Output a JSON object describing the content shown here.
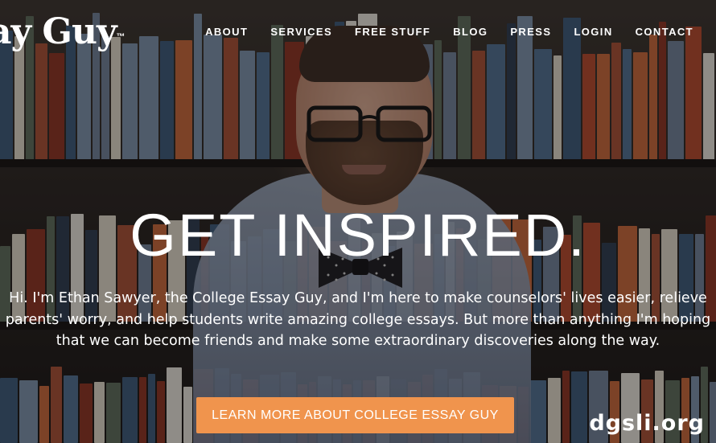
{
  "site": {
    "logo_text": "ay Guy",
    "logo_tm": "™"
  },
  "nav": {
    "items": [
      {
        "label": "ABOUT"
      },
      {
        "label": "SERVICES"
      },
      {
        "label": "FREE STUFF"
      },
      {
        "label": "BLOG"
      },
      {
        "label": "PRESS"
      },
      {
        "label": "LOGIN"
      },
      {
        "label": "CONTACT"
      }
    ]
  },
  "hero": {
    "headline": "GET INSPIRED.",
    "intro": "Hi. I'm Ethan Sawyer, the College Essay Guy, and I'm here to make counselors' lives easier, relieve parents' worry, and help students write amazing college essays. But more than anything I'm hoping that we can become friends and make some extraordinary discoveries along the way.",
    "cta_label": "LEARN MORE ABOUT COLLEGE ESSAY GUY"
  },
  "watermark": "dgsli.org",
  "colors": {
    "cta": "#f0944d",
    "text": "#ffffff"
  }
}
